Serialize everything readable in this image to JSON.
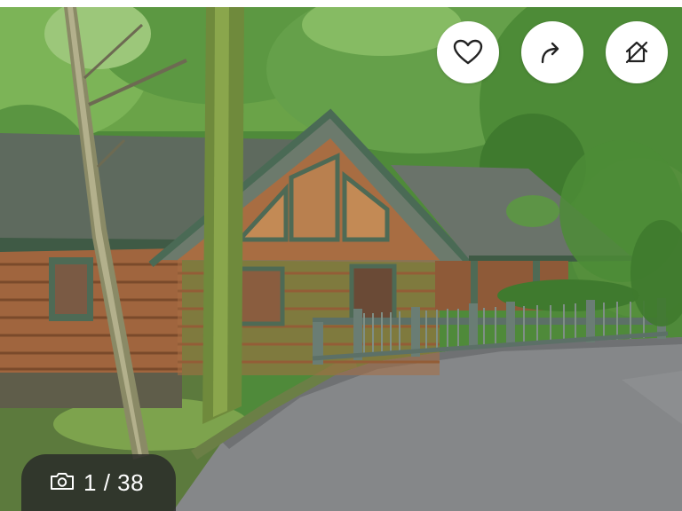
{
  "listing_photo": {
    "alt": "",
    "current_index": "1",
    "separator": " / ",
    "total": "38"
  },
  "actions": [
    {
      "id": "save",
      "icon": "heart-icon"
    },
    {
      "id": "share",
      "icon": "share-arrow-icon"
    },
    {
      "id": "hide",
      "icon": "home-slash-icon"
    }
  ],
  "counter": {
    "icon": "camera-icon"
  },
  "colors": {
    "overlay": "#282828",
    "button_bg": "#ffffff",
    "icon": "#222222"
  }
}
